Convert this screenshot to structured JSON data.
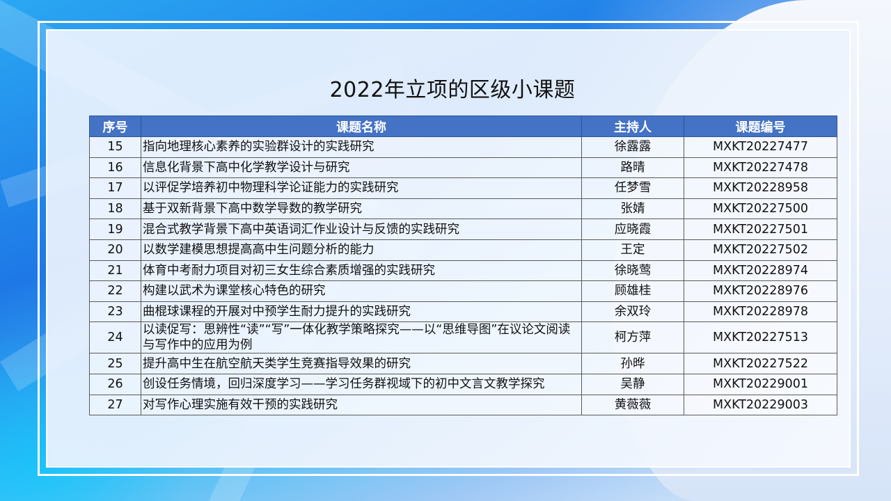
{
  "slide": {
    "title": "2022年立项的区级小课题"
  },
  "table": {
    "headers": [
      "序号",
      "课题名称",
      "主持人",
      "课题编号"
    ],
    "rows": [
      {
        "no": "15",
        "name": "指向地理核心素养的实验群设计的实践研究",
        "host": "徐露露",
        "code": "MXKT20227477"
      },
      {
        "no": "16",
        "name": "信息化背景下高中化学教学设计与研究",
        "host": "路晴",
        "code": "MXKT20227478"
      },
      {
        "no": "17",
        "name": "以评促学培养初中物理科学论证能力的实践研究",
        "host": "任梦雪",
        "code": "MXKT20228958"
      },
      {
        "no": "18",
        "name": "基于双新背景下高中数学导数的教学研究",
        "host": "张婧",
        "code": "MXKT20227500"
      },
      {
        "no": "19",
        "name": "混合式教学背景下高中英语词汇作业设计与反馈的实践研究",
        "host": "应晓霞",
        "code": "MXKT20227501"
      },
      {
        "no": "20",
        "name": "以数学建模思想提高高中生问题分析的能力",
        "host": "王定",
        "code": "MXKT20227502"
      },
      {
        "no": "21",
        "name": "体育中考耐力项目对初三女生综合素质增强的实践研究",
        "host": "徐晓莺",
        "code": "MXKT20228974"
      },
      {
        "no": "22",
        "name": "构建以武术为课堂核心特色的研究",
        "host": "顾雄桂",
        "code": "MXKT20228976"
      },
      {
        "no": "23",
        "name": "曲棍球课程的开展对中预学生耐力提升的实践研究",
        "host": "余双玲",
        "code": "MXKT20228978"
      },
      {
        "no": "24",
        "name": "以读促写：思辨性“读”“写”一体化教学策略探究——以“思维导图”在议论文阅读与写作中的应用为例",
        "host": "柯方萍",
        "code": "MXKT20227513"
      },
      {
        "no": "25",
        "name": "提升高中生在航空航天类学生竞赛指导效果的研究",
        "host": "孙晔",
        "code": "MXKT20227522"
      },
      {
        "no": "26",
        "name": "创设任务情境，回归深度学习——学习任务群视域下的初中文言文教学探究",
        "host": "吴静",
        "code": "MXKT20229001"
      },
      {
        "no": "27",
        "name": "对写作心理实施有效干预的实践研究",
        "host": "黄薇薇",
        "code": "MXKT20229003"
      }
    ]
  }
}
